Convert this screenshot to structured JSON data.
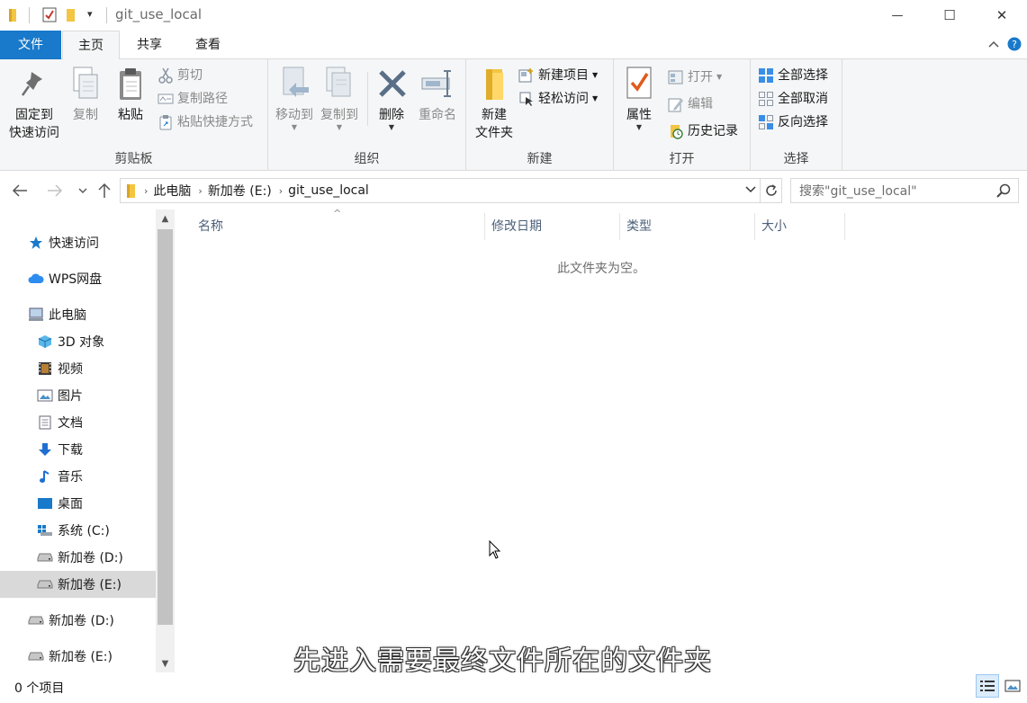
{
  "titlebar": {
    "title": "git_use_local",
    "qat_dropdown": "▾"
  },
  "window_controls": {
    "minimize": "—",
    "maximize": "☐",
    "close": "✕"
  },
  "ribbon_tabs": {
    "file": "文件",
    "home": "主页",
    "share": "共享",
    "view": "查看"
  },
  "ribbon": {
    "clipboard": {
      "label": "剪贴板",
      "pin_line1": "固定到",
      "pin_line2": "快速访问",
      "copy": "复制",
      "paste": "粘贴",
      "cut": "剪切",
      "copy_path": "复制路径",
      "paste_shortcut": "粘贴快捷方式"
    },
    "organize": {
      "label": "组织",
      "move_to": "移动到",
      "copy_to": "复制到",
      "delete": "删除",
      "rename": "重命名"
    },
    "new": {
      "label": "新建",
      "new_folder_line1": "新建",
      "new_folder_line2": "文件夹",
      "new_item": "新建项目",
      "easy_access": "轻松访问"
    },
    "open": {
      "label": "打开",
      "properties": "属性",
      "open": "打开",
      "edit": "编辑",
      "history": "历史记录"
    },
    "select": {
      "label": "选择",
      "select_all": "全部选择",
      "select_none": "全部取消",
      "invert": "反向选择"
    }
  },
  "address": {
    "crumbs": [
      "此电脑",
      "新加卷 (E:)",
      "git_use_local"
    ]
  },
  "search": {
    "placeholder": "搜索\"git_use_local\""
  },
  "nav": {
    "items": [
      {
        "label": "快速访问"
      },
      {
        "label": "WPS网盘"
      },
      {
        "label": "此电脑"
      },
      {
        "label": "3D 对象"
      },
      {
        "label": "视频"
      },
      {
        "label": "图片"
      },
      {
        "label": "文档"
      },
      {
        "label": "下载"
      },
      {
        "label": "音乐"
      },
      {
        "label": "桌面"
      },
      {
        "label": "系统 (C:)"
      },
      {
        "label": "新加卷 (D:)"
      },
      {
        "label": "新加卷 (E:)"
      },
      {
        "label": "新加卷 (D:)"
      },
      {
        "label": "新加卷 (E:)"
      }
    ]
  },
  "columns": {
    "name": "名称",
    "date": "修改日期",
    "type": "类型",
    "size": "大小"
  },
  "content": {
    "empty_message": "此文件夹为空。"
  },
  "status": {
    "count": "0 个项目"
  },
  "subtitle": "先进入需要最终文件所在的文件夹",
  "colors": {
    "accent": "#1979ca",
    "folder": "#f4c542",
    "selected": "#d9d9d9"
  }
}
